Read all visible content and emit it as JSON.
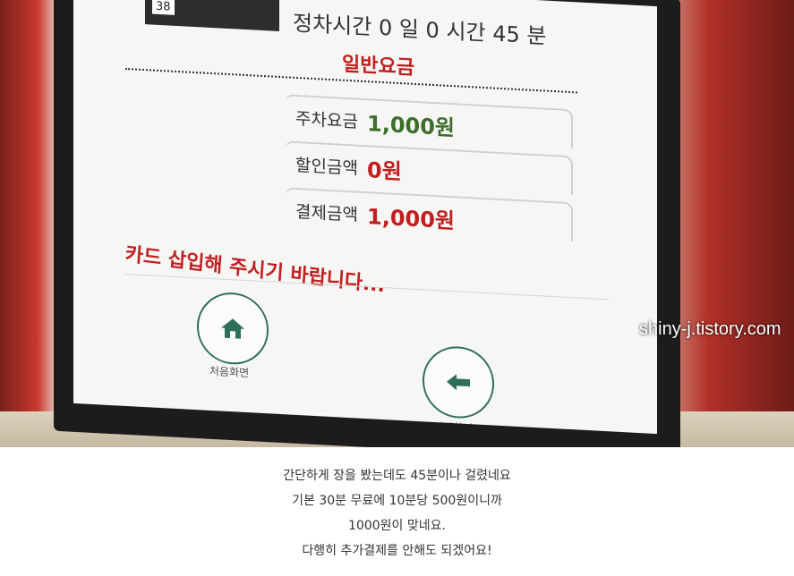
{
  "kiosk": {
    "plate_text": "38",
    "parking_time": "정차시간  0 일 0 시간 45 분",
    "rate_type": "일반요금",
    "fees": [
      {
        "label": "주차요금",
        "value": "1,000원"
      },
      {
        "label": "할인금액",
        "value": "0원"
      },
      {
        "label": "결제금액",
        "value": "1,000원"
      }
    ],
    "insert_message": "카드 삽입해 주시기 바랍니다...",
    "home_button_label": "처음화면",
    "back_button_label": "이전화면",
    "colors": {
      "accent_red": "#c11f1f",
      "accent_green": "#3d6e2a",
      "button_teal": "#2f6e5c",
      "bezel_red": "#b23029"
    }
  },
  "watermark": "shiny-j.tistory.com",
  "caption": [
    "간단하게 장을 봤는데도 45분이나 걸렸네요",
    "기본 30분 무료에 10분당 500원이니까",
    "1000원이 맞네요.",
    "다행히 추가결제를 안해도 되겠어요!"
  ]
}
